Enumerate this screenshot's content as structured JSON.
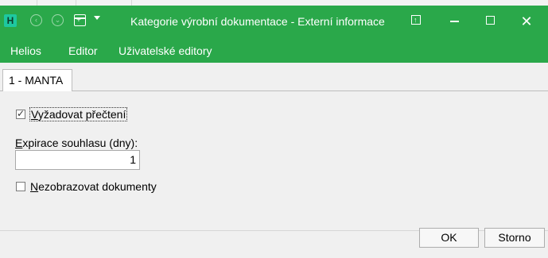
{
  "app": {
    "icon_letter": "H",
    "title": "Kategorie výrobní dokumentace - Externí informace"
  },
  "menubar": {
    "items": [
      {
        "label": "Helios"
      },
      {
        "label": "Editor"
      },
      {
        "label": "Uživatelské editory"
      }
    ]
  },
  "tab": {
    "label": "1 - MANTA"
  },
  "form": {
    "require_read": {
      "label_mnemonic": "V",
      "label_rest": "yžadovat přečtení",
      "checked": true
    },
    "expiration": {
      "label_mnemonic": "E",
      "label_rest": "xpirace souhlasu (dny):",
      "value": "1"
    },
    "hide_documents": {
      "label_mnemonic": "N",
      "label_rest": "ezobrazovat dokumenty",
      "checked": false
    }
  },
  "buttons": {
    "ok": "OK",
    "cancel": "Storno"
  },
  "colors": {
    "titlebar": "#2aa84a",
    "app_icon": "#1ec8a0"
  }
}
